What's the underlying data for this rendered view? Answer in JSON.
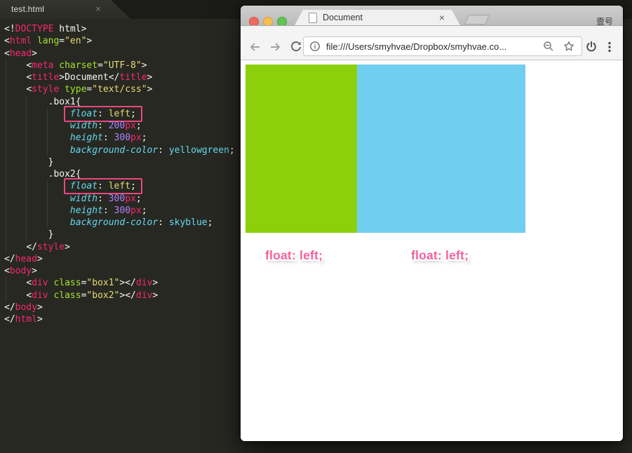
{
  "editor": {
    "tab_title": "test.html",
    "tab_close": "×",
    "code_lines": [
      {
        "seg": [
          [
            "p",
            "<!"
          ],
          [
            "t",
            "DOCTYPE"
          ],
          [
            "w",
            " html"
          ],
          [
            "p",
            ">"
          ]
        ]
      },
      {
        "seg": [
          [
            "p",
            "<"
          ],
          [
            "t",
            "html"
          ],
          [
            "w",
            " "
          ],
          [
            "a",
            "lang"
          ],
          [
            "p",
            "="
          ],
          [
            "s",
            "\"en\""
          ],
          [
            "p",
            ">"
          ]
        ]
      },
      {
        "seg": [
          [
            "p",
            "<"
          ],
          [
            "t",
            "head"
          ],
          [
            "p",
            ">"
          ]
        ]
      },
      {
        "seg": [
          [
            "w",
            "    "
          ],
          [
            "p",
            "<"
          ],
          [
            "t",
            "meta"
          ],
          [
            "w",
            " "
          ],
          [
            "a",
            "charset"
          ],
          [
            "p",
            "="
          ],
          [
            "s",
            "\"UTF-8\""
          ],
          [
            "p",
            ">"
          ]
        ]
      },
      {
        "seg": [
          [
            "w",
            "    "
          ],
          [
            "p",
            "<"
          ],
          [
            "t",
            "title"
          ],
          [
            "p",
            ">"
          ],
          [
            "w",
            "Document"
          ],
          [
            "p",
            "</"
          ],
          [
            "t",
            "title"
          ],
          [
            "p",
            ">"
          ]
        ]
      },
      {
        "seg": [
          [
            "w",
            "    "
          ],
          [
            "p",
            "<"
          ],
          [
            "t",
            "style"
          ],
          [
            "w",
            " "
          ],
          [
            "a",
            "type"
          ],
          [
            "p",
            "="
          ],
          [
            "s",
            "\"text/css\""
          ],
          [
            "p",
            ">"
          ]
        ]
      },
      {
        "seg": [
          [
            "w",
            "        .box1{"
          ]
        ]
      },
      {
        "seg": [
          [
            "w",
            "            "
          ],
          [
            "k",
            "float"
          ],
          [
            "p",
            ": "
          ],
          [
            "v",
            "left"
          ],
          [
            "p",
            ";"
          ]
        ],
        "boxFrom": 1
      },
      {
        "seg": [
          [
            "w",
            "            "
          ],
          [
            "k",
            "width"
          ],
          [
            "p",
            ": "
          ],
          [
            "n",
            "200"
          ],
          [
            "u",
            "px"
          ],
          [
            "p",
            ";"
          ]
        ]
      },
      {
        "seg": [
          [
            "w",
            "            "
          ],
          [
            "k",
            "height"
          ],
          [
            "p",
            ": "
          ],
          [
            "n",
            "300"
          ],
          [
            "u",
            "px"
          ],
          [
            "p",
            ";"
          ]
        ]
      },
      {
        "seg": [
          [
            "w",
            "            "
          ],
          [
            "k",
            "background-color"
          ],
          [
            "p",
            ": "
          ],
          [
            "c",
            "yellowgreen"
          ],
          [
            "p",
            ";"
          ]
        ]
      },
      {
        "seg": [
          [
            "w",
            "        }"
          ]
        ]
      },
      {
        "seg": [
          [
            "w",
            "        .box2{"
          ]
        ]
      },
      {
        "seg": [
          [
            "w",
            "            "
          ],
          [
            "k",
            "float"
          ],
          [
            "p",
            ": "
          ],
          [
            "v",
            "left"
          ],
          [
            "p",
            ";"
          ]
        ],
        "boxFrom": 1
      },
      {
        "seg": [
          [
            "w",
            "            "
          ],
          [
            "k",
            "width"
          ],
          [
            "p",
            ": "
          ],
          [
            "n",
            "300"
          ],
          [
            "u",
            "px"
          ],
          [
            "p",
            ";"
          ]
        ]
      },
      {
        "seg": [
          [
            "w",
            "            "
          ],
          [
            "k",
            "height"
          ],
          [
            "p",
            ": "
          ],
          [
            "n",
            "300"
          ],
          [
            "u",
            "px"
          ],
          [
            "p",
            ";"
          ]
        ]
      },
      {
        "seg": [
          [
            "w",
            "            "
          ],
          [
            "k",
            "background-color"
          ],
          [
            "p",
            ": "
          ],
          [
            "c",
            "skyblue"
          ],
          [
            "p",
            ";"
          ]
        ]
      },
      {
        "seg": [
          [
            "w",
            "        }"
          ]
        ]
      },
      {
        "seg": [
          [
            "w",
            "    "
          ],
          [
            "p",
            "</"
          ],
          [
            "t",
            "style"
          ],
          [
            "p",
            ">"
          ]
        ]
      },
      {
        "seg": [
          [
            "p",
            "</"
          ],
          [
            "t",
            "head"
          ],
          [
            "p",
            ">"
          ]
        ]
      },
      {
        "seg": [
          [
            "p",
            "<"
          ],
          [
            "t",
            "body"
          ],
          [
            "p",
            ">"
          ]
        ]
      },
      {
        "seg": [
          [
            "w",
            "    "
          ],
          [
            "p",
            "<"
          ],
          [
            "t",
            "div"
          ],
          [
            "w",
            " "
          ],
          [
            "a",
            "class"
          ],
          [
            "p",
            "="
          ],
          [
            "s",
            "\"box1\""
          ],
          [
            "p",
            "></"
          ],
          [
            "t",
            "div"
          ],
          [
            "p",
            ">"
          ]
        ]
      },
      {
        "seg": [
          [
            "w",
            "    "
          ],
          [
            "p",
            "<"
          ],
          [
            "t",
            "div"
          ],
          [
            "w",
            " "
          ],
          [
            "a",
            "class"
          ],
          [
            "p",
            "="
          ],
          [
            "s",
            "\"box2\""
          ],
          [
            "p",
            "></"
          ],
          [
            "t",
            "div"
          ],
          [
            "p",
            ">"
          ]
        ]
      },
      {
        "seg": [
          [
            "p",
            "</"
          ],
          [
            "t",
            "body"
          ],
          [
            "p",
            ">"
          ]
        ]
      },
      {
        "seg": [
          [
            "p",
            "</"
          ],
          [
            "t",
            "html"
          ],
          [
            "p",
            ">"
          ]
        ]
      }
    ]
  },
  "browser": {
    "tab_title": "Document",
    "tab_close": "×",
    "profile_name": "壹号",
    "url": "file:///Users/smyhvae/Dropbox/smyhvae.co...",
    "icons": {
      "back": "back-arrow",
      "forward": "forward-arrow",
      "reload": "reload",
      "page_info": "info-circle",
      "zoom": "zoom-out-magnifier",
      "bookmark": "star-outline",
      "extension": "power",
      "menu": "three-dot-menu"
    },
    "page": {
      "box1_color": "#8bd00a",
      "box2_color": "#70ceef",
      "label1": "float: left;",
      "label2": "float: left;"
    }
  }
}
